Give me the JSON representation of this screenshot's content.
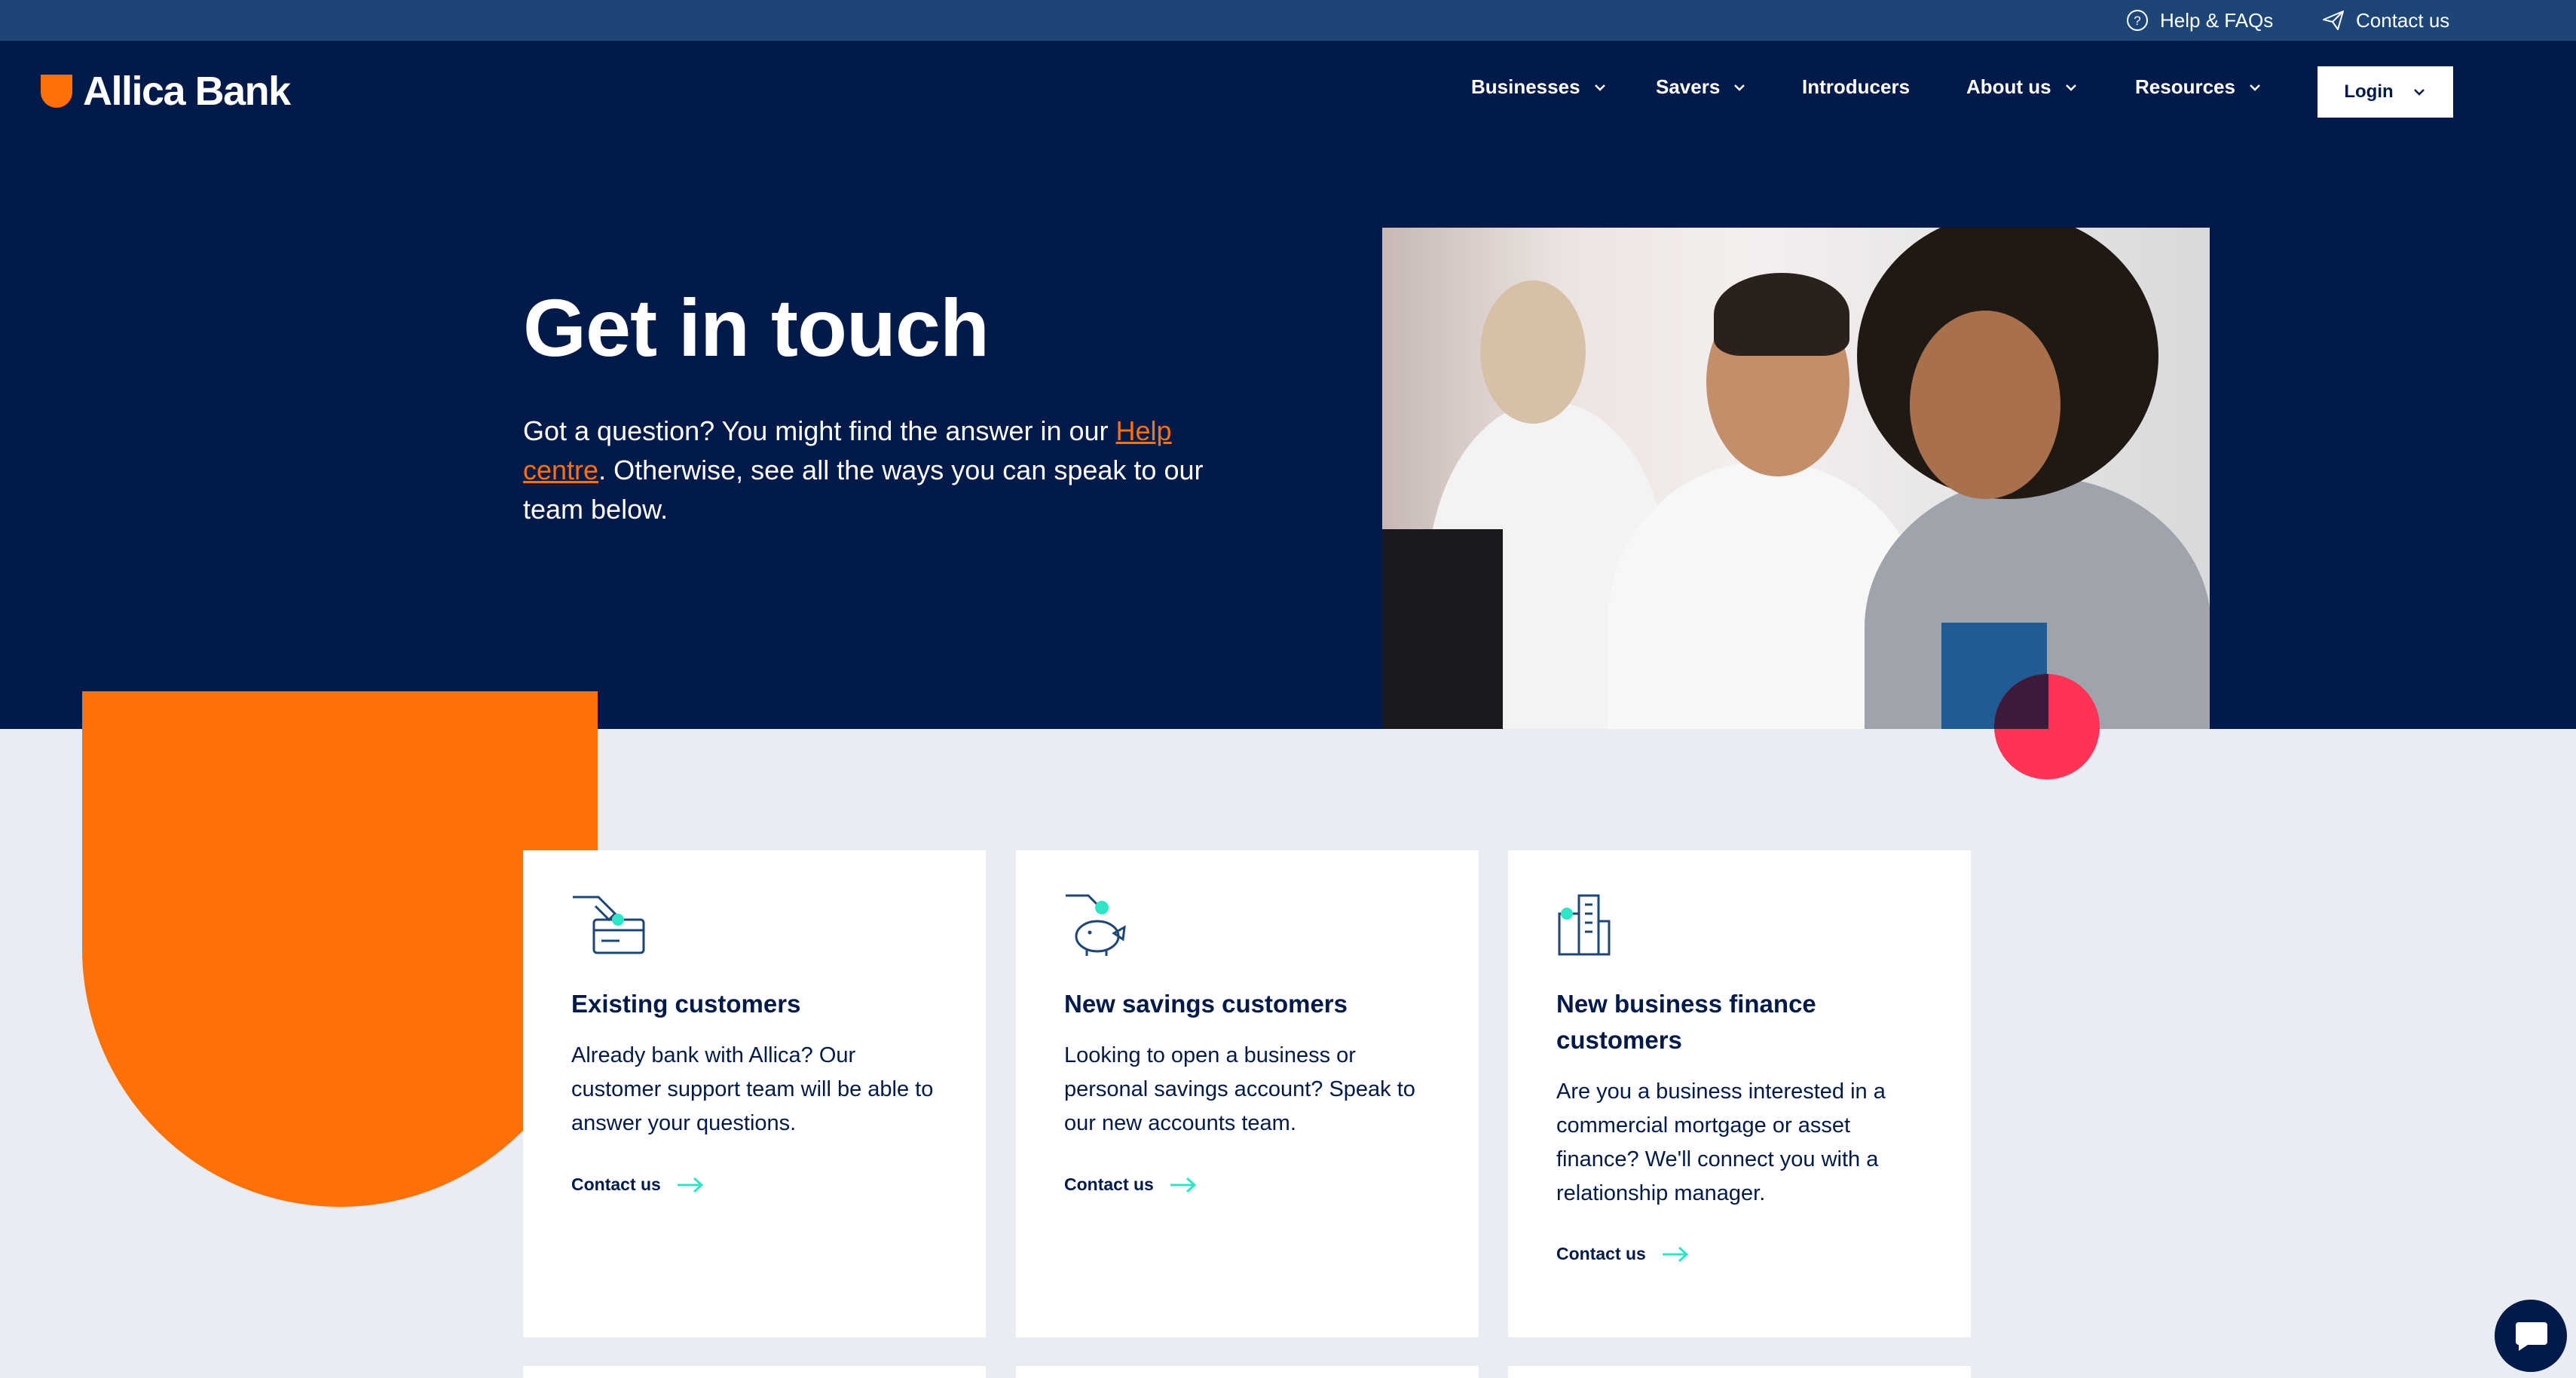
{
  "utility_bar": {
    "help_label": "Help & FAQs",
    "contact_label": "Contact us",
    "help_icon": "question-circle-icon",
    "contact_icon": "paper-plane-icon"
  },
  "header": {
    "brand": "Allica Bank",
    "nav": {
      "businesses": "Businesses",
      "savers": "Savers",
      "introducers": "Introducers",
      "about": "About us",
      "resources": "Resources"
    },
    "login_label": "Login"
  },
  "hero": {
    "title": "Get in touch",
    "intro_before": "Got a question? You might find the answer in our ",
    "intro_link": "Help centre",
    "intro_after": ". Otherwise, see all the ways you can speak to our team below."
  },
  "cards": [
    {
      "icon": "card-payment-icon",
      "title": "Existing customers",
      "description": "Already bank with Allica? Our customer support team will be able to answer your questions.",
      "link": "Contact us"
    },
    {
      "icon": "piggy-bank-icon",
      "title": "New savings customers",
      "description": "Looking to open a business or personal savings account? Speak to our new accounts team.",
      "link": "Contact us"
    },
    {
      "icon": "office-building-icon",
      "title": "New business finance customers",
      "description": "Are you a business interested in a commercial mortgage or asset finance? We'll connect you with a relationship manager.",
      "link": "Contact us"
    }
  ],
  "colors": {
    "navy": "#011a4a",
    "utility_blue": "#1d4677",
    "orange": "#ff7006",
    "pink": "#ff3355",
    "teal": "#2ee6c5",
    "page_bg": "#e9edf3"
  }
}
